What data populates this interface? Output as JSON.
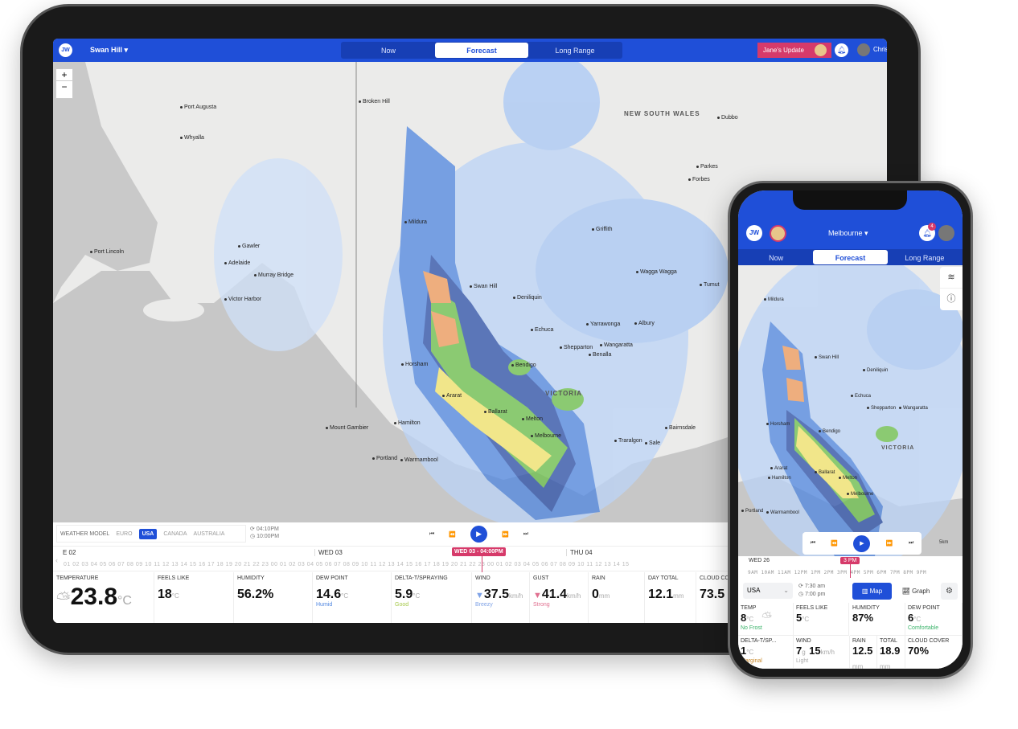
{
  "tablet": {
    "logo": "JW",
    "location": "Swan Hill",
    "tabs": [
      {
        "label": "Now"
      },
      {
        "label": "Forecast"
      },
      {
        "label": "Long Range"
      }
    ],
    "update_button": "Jane's Update",
    "user": "Chris",
    "zoom_in": "+",
    "zoom_out": "−",
    "map": {
      "cities": [
        "Broken Hill",
        "Port Augusta",
        "Whyalla",
        "Port Lincoln",
        "Gawler",
        "Adelaide",
        "Murray Bridge",
        "Victor Harbor",
        "Mildura",
        "Swan Hill",
        "Deniliquin",
        "Griffith",
        "Wagga Wagga",
        "Tumut",
        "Dubbo",
        "Parkes",
        "Forbes",
        "Echuca",
        "Shepparton",
        "Yarrawonga",
        "Albury",
        "Wangaratta",
        "Benalla",
        "Horsham",
        "Bendigo",
        "Ararat",
        "Ballarat",
        "Melton",
        "Melbourne",
        "Hamilton",
        "Mount Gambier",
        "Portland",
        "Warrnambool",
        "Traralgon",
        "Sale",
        "Bairnsdale"
      ],
      "states": [
        "NEW SOUTH WALES",
        "VICTORIA"
      ]
    },
    "weather_model": {
      "label": "WEATHER MODEL",
      "options": [
        "EURO",
        "USA",
        "CANADA",
        "AUSTRALIA"
      ],
      "selected": "USA"
    },
    "sunrise": "04:10PM",
    "sunset": "10:00PM",
    "timeline": {
      "days": [
        "E 02",
        "WED 03",
        "THU 04"
      ],
      "current": "WED 03 - 04:00PM",
      "hours": "01 02 03 04 05 06 07 08 09 10 11 12 13 14 15 16 17 18 19 20 21 22 23 00 01 02 03 04 05 06 07 08 09 10 11 12 13 14 15 16 17 18 19 20 21 22 23 00 01 02 03 04 05 06 07 08 09 10 11 12 13 14 15"
    },
    "stats": [
      {
        "label": "TEMPERATURE",
        "value": "23.8",
        "unit": "°C",
        "note": ""
      },
      {
        "label": "FEELS LIKE",
        "value": "18",
        "unit": "°C",
        "note": ""
      },
      {
        "label": "HUMIDITY",
        "value": "56.2%",
        "unit": "",
        "note": ""
      },
      {
        "label": "DEW POINT",
        "value": "14.6",
        "unit": "°C",
        "note": "Humid"
      },
      {
        "label": "DELTA-T/SPRAYING",
        "value": "5.9",
        "unit": "°C",
        "note": "Good"
      },
      {
        "label": "WIND",
        "value": "37.5",
        "unit": "km/h",
        "note": "Breezy"
      },
      {
        "label": "GUST",
        "value": "41.4",
        "unit": "km/h",
        "note": "Strong"
      },
      {
        "label": "RAIN",
        "value": "0",
        "unit": "mm",
        "note": ""
      },
      {
        "label": "DAY TOTAL",
        "value": "12.1",
        "unit": "mm",
        "note": ""
      },
      {
        "label": "CLOUD CO",
        "value": "73.5",
        "unit": "",
        "note": ""
      }
    ]
  },
  "phone": {
    "logo": "JW",
    "location": "Melbourne",
    "notifications": "4",
    "tabs": [
      {
        "label": "Now"
      },
      {
        "label": "Forecast"
      },
      {
        "label": "Long Range"
      }
    ],
    "map": {
      "cities": [
        "Mildura",
        "Swan Hill",
        "Deniliquin",
        "Echuca",
        "Shepparton",
        "Wangaratta",
        "Horsham",
        "Bendigo",
        "Ararat",
        "Ballarat",
        "Melton",
        "Melbourne",
        "Hamilton",
        "Portland",
        "Warrnambool"
      ],
      "states": [
        "VICTORIA"
      ],
      "scale": "5km"
    },
    "timeline": {
      "day": "WED 26",
      "current": "3 PM",
      "hours": "9AM 10AM 11AM 12PM 1PM 2PM 3PM 4PM 5PM 6PM 7PM 8PM 9PM"
    },
    "model": "USA",
    "sunrise": "7:30 am",
    "sunset": "7:00 pm",
    "map_button": "Map",
    "graph_button": "Graph",
    "stats": [
      {
        "label": "TEMP",
        "value": "8",
        "unit": "°C",
        "note": "No Frost"
      },
      {
        "label": "FEELS LIKE",
        "value": "5",
        "unit": "°C",
        "note": ""
      },
      {
        "label": "HUMIDITY",
        "value": "87%",
        "unit": "",
        "note": ""
      },
      {
        "label": "DEW POINT",
        "value": "6",
        "unit": "°C",
        "note": "Comfortable"
      },
      {
        "label": "DELTA-T/SP...",
        "value": "1",
        "unit": "°C",
        "note": "Marginal"
      },
      {
        "label": "WIND",
        "value": "7",
        "unit": "g",
        "value2": "15",
        "unit2": "km/h",
        "note": "Light"
      },
      {
        "label": "RAIN",
        "value": "12.5",
        "unit": "mm",
        "note": ""
      },
      {
        "label": "TOTAL",
        "value": "18.9",
        "unit": "mm",
        "note": ""
      },
      {
        "label": "CLOUD COVER",
        "value": "70%",
        "unit": "",
        "note": ""
      }
    ]
  },
  "colors": {
    "brand": "#1f4fd8",
    "accent": "#d63a6a",
    "rain_light": "#a9c8f5",
    "rain_mid": "#4f86e0",
    "rain_heavy": "#2c4fa8",
    "green": "#6cc04a",
    "yellow": "#f3e56a",
    "orange": "#f09a5a"
  }
}
